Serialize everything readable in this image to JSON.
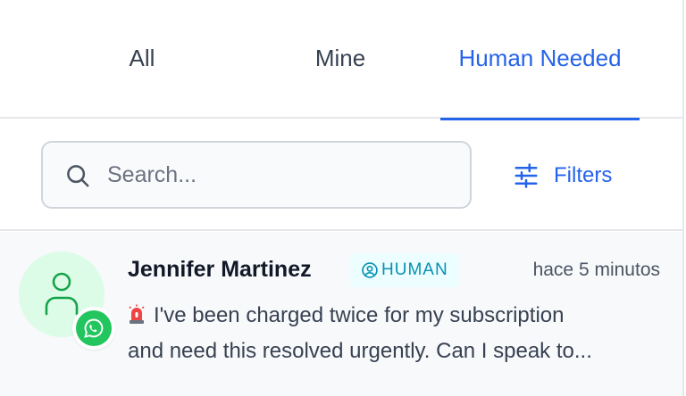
{
  "tabs": [
    {
      "label": "All",
      "active": false
    },
    {
      "label": "Mine",
      "active": false
    },
    {
      "label": "Human Needed",
      "active": true
    }
  ],
  "search": {
    "placeholder": "Search...",
    "value": ""
  },
  "filters": {
    "label": "Filters",
    "icon": "sliders-icon"
  },
  "conversations": [
    {
      "name": "Jennifer Martinez",
      "badge": "HUMAN",
      "badge_icon": "user-circle-icon",
      "time": "hace 5 minutos",
      "channel_icon": "whatsapp-icon",
      "preview_line_1": "I've been charged twice for my subscription",
      "preview_line_2": "and need this resolved urgently. Can I speak to...",
      "preview_emoji": "siren-icon"
    }
  ],
  "colors": {
    "accent": "#2563eb",
    "badge_text": "#0891b2",
    "badge_bg": "#ecfeff",
    "avatar_bg": "#dcfce7",
    "whatsapp": "#22c55e"
  }
}
